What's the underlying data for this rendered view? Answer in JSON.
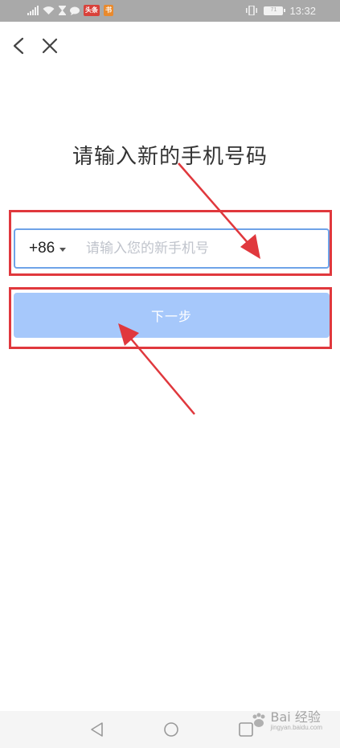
{
  "status_bar": {
    "signal_text": "4G",
    "badge_red": "头条",
    "badge_orange": "书",
    "battery": "71",
    "time": "13:32"
  },
  "header": {
    "back_icon": "chevron-left-icon",
    "close_icon": "close-icon"
  },
  "main": {
    "title": "请输入新的手机号码",
    "country_code": "+86",
    "phone_placeholder": "请输入您的新手机号",
    "phone_value": "",
    "next_label": "下一步"
  },
  "colors": {
    "input_border": "#6fa3e8",
    "button_bg": "#a6c8fb",
    "annotation": "#e0383d"
  },
  "watermark": {
    "text": "Bai 经验",
    "url": "jingyan.baidu.com"
  }
}
